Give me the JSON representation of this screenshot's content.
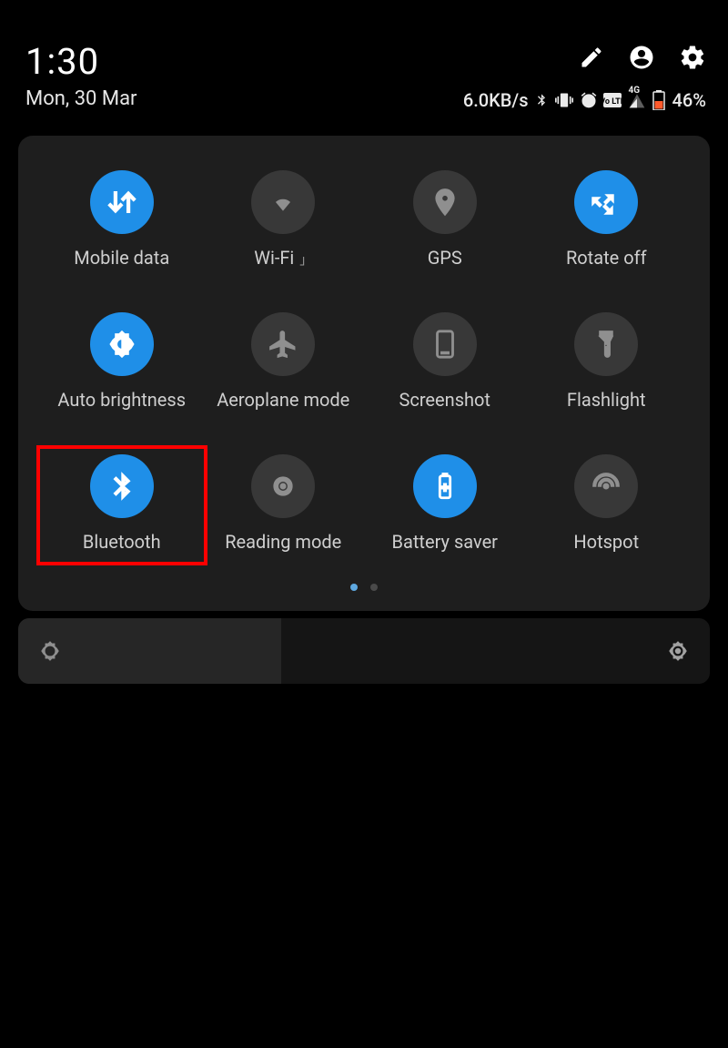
{
  "header": {
    "time": "1:30",
    "date": "Mon, 30 Mar"
  },
  "status": {
    "speed": "6.0KB/s",
    "signal_label": "4G",
    "battery_percent": "46%"
  },
  "tiles": [
    {
      "label": "Mobile data",
      "icon": "mobile-data-icon",
      "active": true
    },
    {
      "label": "Wi-Fi",
      "icon": "wifi-icon",
      "active": false,
      "sub": "」"
    },
    {
      "label": "GPS",
      "icon": "gps-icon",
      "active": false
    },
    {
      "label": "Rotate off",
      "icon": "rotate-icon",
      "active": true
    },
    {
      "label": "Auto brightness",
      "icon": "brightness-icon",
      "active": true
    },
    {
      "label": "Aeroplane mode",
      "icon": "airplane-icon",
      "active": false
    },
    {
      "label": "Screenshot",
      "icon": "screenshot-icon",
      "active": false
    },
    {
      "label": "Flashlight",
      "icon": "flashlight-icon",
      "active": false
    },
    {
      "label": "Bluetooth",
      "icon": "bluetooth-icon",
      "active": true,
      "highlight": true
    },
    {
      "label": "Reading mode",
      "icon": "reading-icon",
      "active": false
    },
    {
      "label": "Battery saver",
      "icon": "battery-saver-icon",
      "active": true
    },
    {
      "label": "Hotspot",
      "icon": "hotspot-icon",
      "active": false
    }
  ],
  "pager": {
    "active": 0,
    "count": 2
  }
}
